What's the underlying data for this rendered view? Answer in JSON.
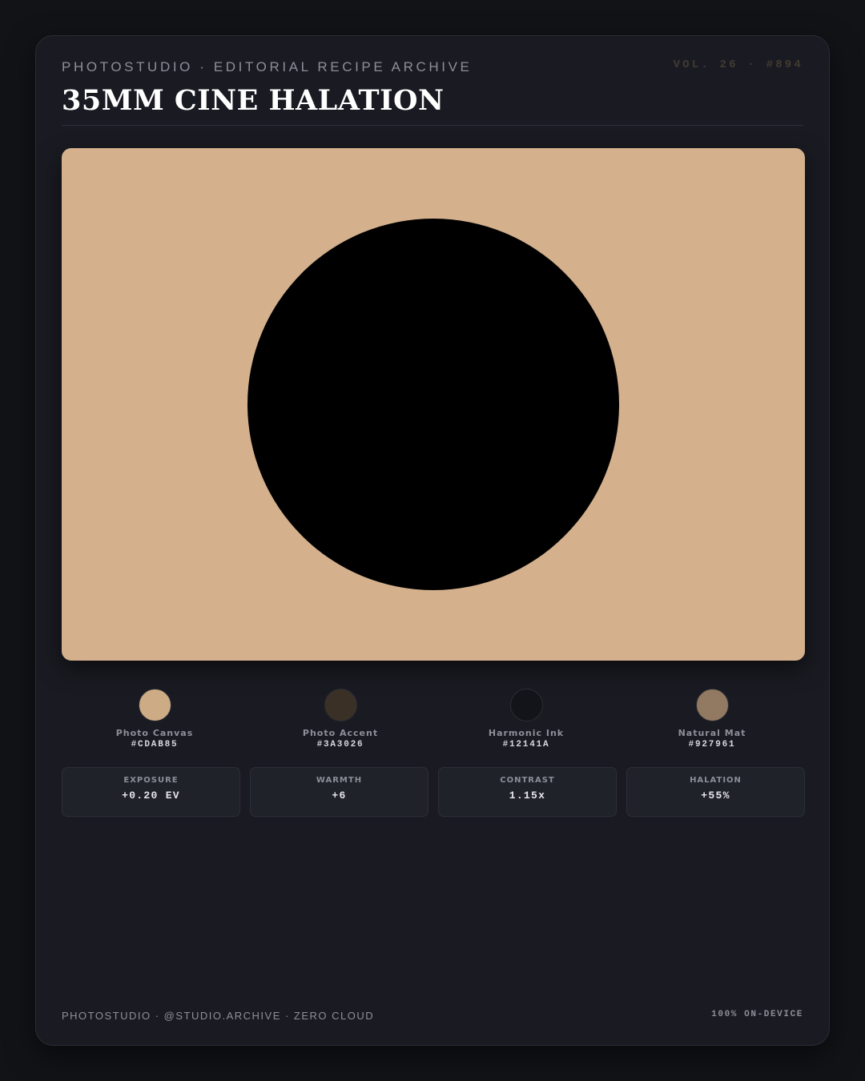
{
  "header": {
    "eyebrow": "PHOTOSTUDIO · EDITORIAL RECIPE ARCHIVE",
    "volume": "VOL. 26 · #894",
    "title": "35MM CINE HALATION"
  },
  "photo": {
    "background_color": "#D4B08D",
    "subject_color": "#000000"
  },
  "palette": [
    {
      "name": "Photo Canvas",
      "hex": "#CDAB85"
    },
    {
      "name": "Photo Accent",
      "hex": "#3A3026"
    },
    {
      "name": "Harmonic Ink",
      "hex": "#12141A"
    },
    {
      "name": "Natural Mat",
      "hex": "#927961"
    }
  ],
  "adjustments": [
    {
      "label": "EXPOSURE",
      "value": "+0.20 EV"
    },
    {
      "label": "WARMTH",
      "value": "+6"
    },
    {
      "label": "CONTRAST",
      "value": "1.15x"
    },
    {
      "label": "HALATION",
      "value": "+55%"
    }
  ],
  "footer": {
    "left": "PHOTOSTUDIO · @STUDIO.ARCHIVE · ZERO CLOUD",
    "right": "100% ON-DEVICE"
  }
}
